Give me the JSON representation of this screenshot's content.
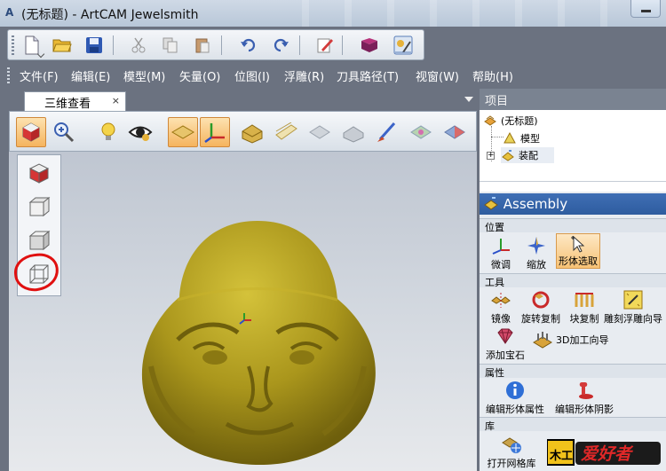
{
  "window": {
    "title": "(无标题) - ArtCAM Jewelsmith",
    "app_icon_label": "A"
  },
  "menu": {
    "items": [
      "文件(F)",
      "编辑(E)",
      "模型(M)",
      "矢量(O)",
      "位图(I)",
      "浮雕(R)",
      "刀具路径(T)",
      "视窗(W)",
      "帮助(H)"
    ]
  },
  "toolbar": {
    "icons": [
      "new-file-icon",
      "open-folder-icon",
      "save-icon",
      "cut-icon",
      "copy-icon",
      "paste-icon",
      "undo-icon",
      "redo-icon",
      "edit-icon",
      "book-icon",
      "settings-icon"
    ]
  },
  "document": {
    "tab_label": "三维查看",
    "tab_close": "×"
  },
  "view_toolbar": {
    "icons": [
      "cube-view-icon",
      "zoom-icon",
      "light-icon",
      "eye-icon",
      "plane-icon",
      "axis-icon",
      "relief-icon",
      "layers-icon",
      "grey-block-icon",
      "grey-block2-icon",
      "brush-icon",
      "colour-plane-icon",
      "colour-plane2-icon"
    ]
  },
  "view_popup": {
    "items": [
      "iso-view-icon",
      "front-view-icon",
      "side-view-icon",
      "back-view-icon"
    ]
  },
  "project_panel": {
    "header": "项目",
    "tree": {
      "root": "(无标题)",
      "child_model": "模型",
      "child_assembly": "装配",
      "expander": "+"
    }
  },
  "assembly_panel": {
    "header": "Assembly",
    "sections": {
      "position": {
        "title": "位置",
        "tools": [
          "微调",
          "缩放",
          "形体选取"
        ]
      },
      "tools": {
        "title": "工具",
        "tools": [
          "镜像",
          "旋转复制",
          "块复制",
          "雕刻浮雕向导"
        ],
        "extra_gem": "添加宝石",
        "extra_3d": "3D加工向导"
      },
      "properties": {
        "title": "属性",
        "tools": [
          "编辑形体属性",
          "编辑形体阴影"
        ]
      },
      "library": {
        "title": "库",
        "tools": [
          "打开网格库"
        ]
      }
    }
  },
  "watermark": {
    "text": "爱好者",
    "prefix": "木工"
  },
  "colors": {
    "accent_orange": "#f5b45e",
    "assembly_blue": "#2e5c9f",
    "relief_gold": "#a8951f",
    "highlight_red": "#e01010"
  }
}
